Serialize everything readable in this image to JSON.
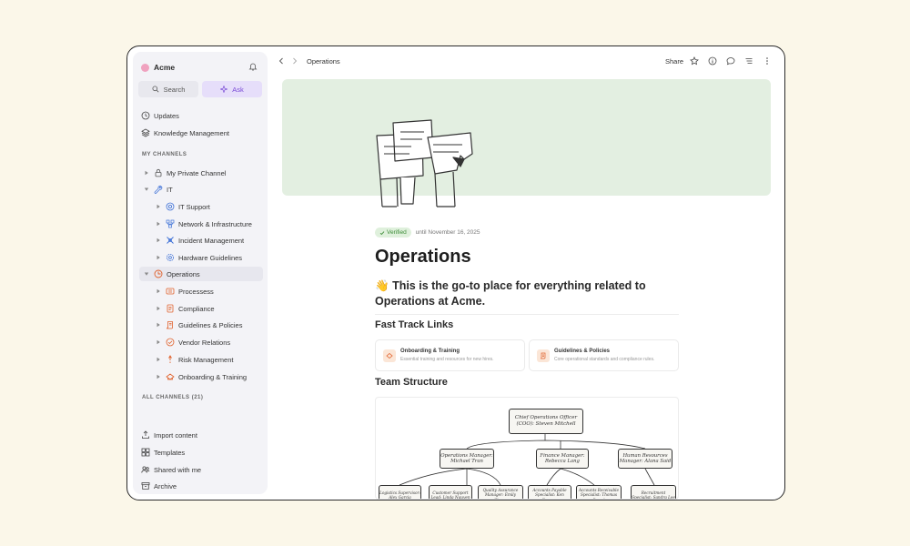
{
  "workspace": {
    "name": "Acme"
  },
  "sidebar": {
    "search_label": "Search",
    "ask_label": "Ask",
    "top_items": [
      {
        "label": "Updates",
        "icon": "clock-icon"
      },
      {
        "label": "Knowledge Management",
        "icon": "layers-icon"
      }
    ],
    "my_channels_heading": "MY CHANNELS",
    "channels": [
      {
        "label": "My Private Channel",
        "icon": "lock-icon"
      },
      {
        "label": "IT",
        "icon": "wrench-icon"
      },
      {
        "label": "IT Support",
        "icon": "support-icon"
      },
      {
        "label": "Network & Infrastructure",
        "icon": "network-icon"
      },
      {
        "label": "Incident Management",
        "icon": "incident-icon"
      },
      {
        "label": "Hardware Guidelines",
        "icon": "gear-icon"
      },
      {
        "label": "Operations",
        "icon": "operations-icon"
      },
      {
        "label": "Processess",
        "icon": "process-icon"
      },
      {
        "label": "Compliance",
        "icon": "compliance-icon"
      },
      {
        "label": "Guidelines & Policies",
        "icon": "scroll-icon"
      },
      {
        "label": "Vendor Relations",
        "icon": "vendor-icon"
      },
      {
        "label": "Risk Management",
        "icon": "risk-icon"
      },
      {
        "label": "Onboarding & Training",
        "icon": "onboarding-icon"
      }
    ],
    "all_channels_heading": "ALL CHANNELS (21)",
    "bottom_items": [
      {
        "label": "Import content",
        "icon": "import-icon"
      },
      {
        "label": "Templates",
        "icon": "templates-icon"
      },
      {
        "label": "Shared with me",
        "icon": "people-icon"
      },
      {
        "label": "Archive",
        "icon": "archive-icon"
      }
    ]
  },
  "topbar": {
    "breadcrumb": "Operations",
    "share_label": "Share"
  },
  "page": {
    "verified_label": "Verified",
    "verified_until": "until November 16, 2025",
    "title": "Operations",
    "lead_emoji": "👋",
    "lead_text": "This is the go-to place for everything related to Operations at Acme.",
    "fast_track_heading": "Fast Track Links",
    "fast_track": [
      {
        "title": "Onboarding & Training",
        "description": "Essential training and resources for new hires."
      },
      {
        "title": "Guidelines & Policies",
        "description": "Core operational standards and compliance rules."
      }
    ],
    "team_heading": "Team Structure",
    "org": {
      "root": "Chief Operations Officer (COO): Steven Mitchell",
      "level2": [
        "Operations Manager: Michael Tran",
        "Finance Manager: Rebecca Lang",
        "Human Resources Manager: Alana Said"
      ],
      "level3": [
        "Logistics Supervisor: Alex Garcia",
        "Customer Support Lead: Linda Nguyen",
        "Quality Assurance Manager: Emily Zhang",
        "Accounts Payable Specialist: Ken Engwer",
        "Accounts Receivable Specialist: Thomas Brand",
        "Recruitment Specialist: Sandra Lee"
      ]
    }
  }
}
